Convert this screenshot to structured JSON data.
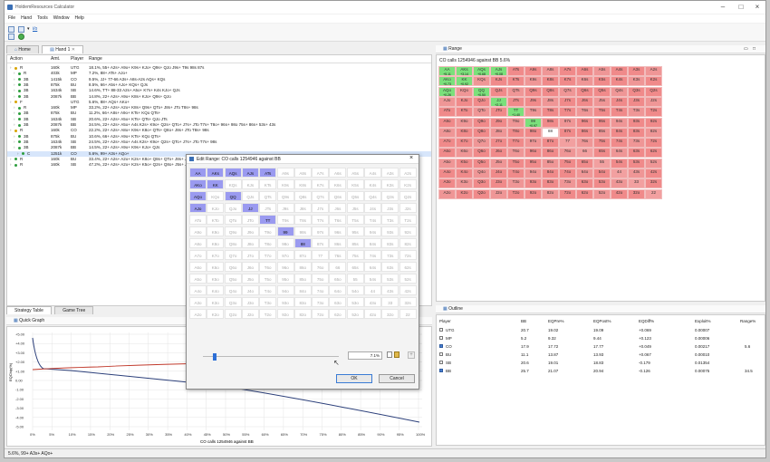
{
  "window": {
    "title": "HoldemResources Calculator"
  },
  "menu": [
    "File",
    "Hand",
    "Tools",
    "Window",
    "Help"
  ],
  "tabs": {
    "home": "Home",
    "hand": "Hand 1"
  },
  "hand_table": {
    "headers": [
      "Action",
      "Amt.",
      "Player",
      "Range"
    ],
    "rows": [
      {
        "action": "R",
        "amt": "160k",
        "player": "UTG",
        "range": "18.1%, 55+ A2s+ A9o+ K9s+ KJo+ Q9s+ QJo J9s+ T9s 98s 87s",
        "indent": 0,
        "icon": "gold"
      },
      {
        "action": "R",
        "amt": "403k",
        "player": "MP",
        "range": "7.2%, 88+ ATs+ AJo+",
        "indent": 1,
        "icon": "green"
      },
      {
        "action": "3B",
        "amt": "1415k",
        "player": "CO",
        "range": "9.5%, JJ+ 77-66 A3s+ A8s-A2s AQs+ KQs",
        "indent": 1,
        "icon": "green"
      },
      {
        "action": "3B",
        "amt": "875k",
        "player": "BU",
        "range": "8.5%, 66+ A5s+ AJo+ KQs+ QJs",
        "indent": 1,
        "icon": "green"
      },
      {
        "action": "3B",
        "amt": "1634k",
        "player": "SB",
        "range": "14.6%, TT+ 88-33 A2s+ A5o+ K7s+ K4s KJo+ QJs",
        "indent": 1,
        "icon": "green"
      },
      {
        "action": "3B",
        "amt": "2087k",
        "player": "BB",
        "range": "14.8%, 22+ A2s+ A9o+ K8s+ KJo+ Q9s+ QJo",
        "indent": 1,
        "icon": "green"
      },
      {
        "action": "F",
        "amt": "",
        "player": "UTG",
        "range": "5.6%, 88+ AQs+ AKo+",
        "indent": 0,
        "icon": "gold"
      },
      {
        "action": "R",
        "amt": "160k",
        "player": "MP",
        "range": "33.2%, 22+ A2s+ A2o+ K8s+ Q9s+ QTo+ J8s+ JTo T8s+ 98s",
        "indent": 1,
        "icon": "green"
      },
      {
        "action": "3B",
        "amt": "875k",
        "player": "BU",
        "range": "11.2%, 66+ A8s+ A9o+ KTs+ KQo QTs+",
        "indent": 1,
        "icon": "green"
      },
      {
        "action": "3B",
        "amt": "1634k",
        "player": "SB",
        "range": "20.6%, 22+ A2s+ A5o+ KTs+ QTs+ QJo JTs",
        "indent": 1,
        "icon": "green"
      },
      {
        "action": "3B",
        "amt": "2087k",
        "player": "BB",
        "range": "34.5%, 22+ A2s+ A5o+ A4s K2s+ K9o+ Q2s+ QTo+ J7s+ JTo T7s+ T8o+ 96s+ 98o 75s+ 86s+ 53s+ 43s",
        "indent": 1,
        "icon": "green"
      },
      {
        "action": "R",
        "amt": "160k",
        "player": "CO",
        "range": "22.2%, 22+ A2s+ A8o+ K9s+ K8o+ QTs+ Q8o+ J8s+ JTo T8s+ 98s",
        "indent": 0,
        "icon": "gold"
      },
      {
        "action": "3B",
        "amt": "875k",
        "player": "BU",
        "range": "10.6%, 66+ A2s+ A9o+ KTs+ KQo QTs+",
        "indent": 1,
        "icon": "green"
      },
      {
        "action": "3B",
        "amt": "1634k",
        "player": "SB",
        "range": "24.5%, 22+ A2s+ A5o+ A4s K2s+ K9o+ Q2s+ QTo+ J7s+ JTo T7s+ 98s",
        "indent": 1,
        "icon": "green"
      },
      {
        "action": "3B",
        "amt": "2087k",
        "player": "BB",
        "range": "14.5%, 22+ A2s+ A9o+ K9s+ KJo+ QJs",
        "indent": 1,
        "icon": "green"
      },
      {
        "action": "C",
        "amt": "1251k",
        "player": "CO",
        "range": "5.6%, 99+ A3s+ AQo+",
        "indent": 2,
        "icon": "green",
        "selected": true
      },
      {
        "action": "R",
        "amt": "160k",
        "player": "BU",
        "range": "33.4%, 22+ A2s+ A2o+ K2s+ K8o+ Q8s+ QTo+ J8s+ JTo T8s+ 98s",
        "indent": 0,
        "icon": "green"
      },
      {
        "action": "R",
        "amt": "160k",
        "player": "SB",
        "range": "47.2%, 22+ A2s+ A2o+ K2s+ K5o+ Q2s+ Q8o+ J5s+ J8o+ T6s+ T8o+ 96s+ 98o",
        "indent": 0,
        "icon": "green"
      }
    ]
  },
  "lower_tabs": {
    "strategy": "Strategy Table",
    "game_tree": "Game Tree"
  },
  "quick_graph": {
    "title": "Quick Graph",
    "xlabel": "CO calls 1254946 against BB",
    "ylabel": "EQChip(%)",
    "y_ticks": [
      "+5.00",
      "+4.00",
      "+3.00",
      "+2.00",
      "+1.00",
      "0.00",
      "-1.00",
      "-2.00",
      "-3.00",
      "-4.00",
      "-5.00"
    ],
    "x_ticks": [
      "0%",
      "5%",
      "10%",
      "15%",
      "20%",
      "25%",
      "30%",
      "35%",
      "40%",
      "45%",
      "50%",
      "55%",
      "60%",
      "65%",
      "70%",
      "75%",
      "80%",
      "85%",
      "90%",
      "95%",
      "100%"
    ]
  },
  "range_panel": {
    "title": "Range",
    "subtitle": "CO calls 1254946 against BB 5.6%",
    "highlight": {
      "0,0": "+5.11",
      "0,1": "+3.14",
      "0,2": "+0.68",
      "0,3": "+0.08",
      "1,0": "+0.73",
      "1,1": "+0.92",
      "2,0": "+0.26",
      "2,2": "+0.50",
      "3,3": "+2.11",
      "4,4": "+1.40",
      "5,5": "+0.97",
      "6,6": ""
    }
  },
  "hands_grid": [
    [
      "AA",
      "AKs",
      "AQs",
      "AJs",
      "ATs",
      "A9s",
      "A8s",
      "A7s",
      "A6s",
      "A5s",
      "A4s",
      "A3s",
      "A2s"
    ],
    [
      "AKo",
      "KK",
      "KQs",
      "KJs",
      "KTs",
      "K9s",
      "K8s",
      "K7s",
      "K6s",
      "K5s",
      "K4s",
      "K3s",
      "K2s"
    ],
    [
      "AQo",
      "KQo",
      "QQ",
      "QJs",
      "QTs",
      "Q9s",
      "Q8s",
      "Q7s",
      "Q6s",
      "Q5s",
      "Q4s",
      "Q3s",
      "Q2s"
    ],
    [
      "AJo",
      "KJo",
      "QJo",
      "JJ",
      "JTs",
      "J9s",
      "J8s",
      "J7s",
      "J6s",
      "J5s",
      "J4s",
      "J3s",
      "J2s"
    ],
    [
      "ATo",
      "KTo",
      "QTo",
      "JTo",
      "TT",
      "T9s",
      "T8s",
      "T7s",
      "T6s",
      "T5s",
      "T4s",
      "T3s",
      "T2s"
    ],
    [
      "A9o",
      "K9o",
      "Q9o",
      "J9o",
      "T9o",
      "99",
      "98s",
      "97s",
      "96s",
      "95s",
      "94s",
      "93s",
      "92s"
    ],
    [
      "A8o",
      "K8o",
      "Q8o",
      "J8o",
      "T8o",
      "98o",
      "88",
      "87s",
      "86s",
      "85s",
      "84s",
      "83s",
      "82s"
    ],
    [
      "A7o",
      "K7o",
      "Q7o",
      "J7o",
      "T7o",
      "97o",
      "87o",
      "77",
      "76s",
      "75s",
      "74s",
      "73s",
      "72s"
    ],
    [
      "A6o",
      "K6o",
      "Q6o",
      "J6o",
      "T6o",
      "96o",
      "86o",
      "76o",
      "66",
      "65s",
      "64s",
      "63s",
      "62s"
    ],
    [
      "A5o",
      "K5o",
      "Q5o",
      "J5o",
      "T5o",
      "95o",
      "85o",
      "75o",
      "65o",
      "55",
      "54s",
      "53s",
      "52s"
    ],
    [
      "A4o",
      "K4o",
      "Q4o",
      "J4o",
      "T4o",
      "94o",
      "84o",
      "74o",
      "64o",
      "54o",
      "44",
      "43s",
      "42s"
    ],
    [
      "A3o",
      "K3o",
      "Q3o",
      "J3o",
      "T3o",
      "93o",
      "83o",
      "73o",
      "63o",
      "53o",
      "43o",
      "33",
      "32s"
    ],
    [
      "A2o",
      "K2o",
      "Q2o",
      "J2o",
      "T2o",
      "92o",
      "82o",
      "72o",
      "62o",
      "52o",
      "42o",
      "32o",
      "22"
    ]
  ],
  "dialog": {
    "title": "Edit Range: CO calls 1254946 against BB",
    "selected": [
      "0,0",
      "0,1",
      "0,2",
      "0,3",
      "0,4",
      "1,0",
      "1,1",
      "2,0",
      "2,2",
      "3,0",
      "3,3",
      "4,4",
      "5,5",
      "6,6"
    ],
    "percent": "7.1%",
    "ok": "OK",
    "cancel": "Cancel"
  },
  "outline": {
    "title": "Outline",
    "headers": [
      "Player",
      "BB",
      "EQPre%",
      "EQPost%",
      "EQDiff%",
      "Exploit%",
      "Range%"
    ],
    "rows": [
      {
        "player": "UTG",
        "bb": "20.7",
        "pre": "19.02",
        "post": "19.09",
        "diff": "+0.069",
        "exploit": "0.00007",
        "range": "",
        "checked": false
      },
      {
        "player": "MP",
        "bb": "5.2",
        "pre": "9.32",
        "post": "9.44",
        "diff": "+0.123",
        "exploit": "0.00006",
        "range": "",
        "checked": false
      },
      {
        "player": "CO",
        "bb": "17.9",
        "pre": "17.72",
        "post": "17.77",
        "diff": "+0.049",
        "exploit": "0.00217",
        "range": "5.6",
        "checked": true
      },
      {
        "player": "BU",
        "bb": "11.1",
        "pre": "13.87",
        "post": "13.93",
        "diff": "+0.067",
        "exploit": "0.00010",
        "range": "",
        "checked": false
      },
      {
        "player": "SB",
        "bb": "20.6",
        "pre": "19.01",
        "post": "18.83",
        "diff": "-0.179",
        "exploit": "0.01354",
        "range": "",
        "checked": false
      },
      {
        "player": "BB",
        "bb": "25.7",
        "pre": "21.07",
        "post": "20.94",
        "diff": "-0.126",
        "exploit": "0.00075",
        "range": "34.5",
        "checked": true
      }
    ]
  },
  "status": "5.6%, 99+ A3s+ AQo+"
}
